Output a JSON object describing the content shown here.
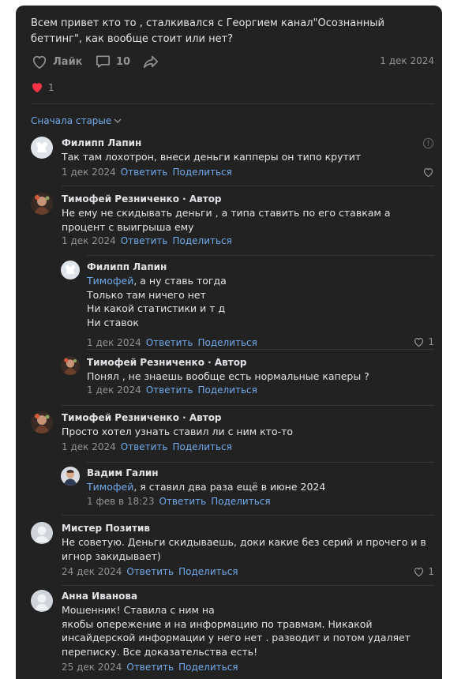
{
  "post": {
    "text": "Всем привет кто то , сталкивался с Георгием канал\"Осознанный беттинг\", как вообще стоит или нет?",
    "like_label": "Лайк",
    "comment_count": "10",
    "date": "1 дек 2024",
    "reaction_count": "1"
  },
  "sort_label": "Сначала старые",
  "reply_label": "Ответить",
  "share_label": "Поделиться",
  "comments": [
    {
      "name": "Филипп Лапин",
      "text": "Так там лохотрон, внеси деньги капперы он типо крутит",
      "date": "1 дек 2024"
    },
    {
      "name": "Тимофей Резниченко · Автор",
      "text": "Не ему не скидывать деньги , а типа ставить по его ставкам а процент с выигрыша ему",
      "date": "1 дек 2024"
    },
    {
      "name": "Филипп Лапин",
      "mention": "Тимофей",
      "text_l1": ", а ну ставь тогда",
      "text_l2": "Только там ничего нет",
      "text_l3": "Ни какой статистики и т д",
      "text_l4": "Ни ставок",
      "date": "1 дек 2024",
      "likes": "1"
    },
    {
      "name": "Тимофей Резниченко · Автор",
      "text": "Понял , не знаешь вообще есть нормальные каперы ?",
      "date": "1 дек 2024"
    },
    {
      "name": "Тимофей Резниченко · Автор",
      "text": "Просто хотел узнать ставил ли с ним кто-то",
      "date": "1 дек 2024"
    },
    {
      "name": "Вадим Галин",
      "mention": "Тимофей",
      "text": ", я ставил два раза ещё в июне 2024",
      "date": "1 фев в 18:23"
    },
    {
      "name": "Мистер Позитив",
      "text": "Не советую. Деньги скидываешь, доки какие без серий и прочего и в игнор закидывает)",
      "date": "24 дек 2024",
      "likes": "1"
    },
    {
      "name": "Анна Иванова",
      "text_l1": "Мошенник! Ставила с ним на",
      "text_l2": "якобы опережение и на информацию по травмам. Никакой инсайдерской информации у него нет . разводит и потом удаляет переписку. Все доказательства есть!",
      "date": "25 дек 2024"
    }
  ],
  "colors": {
    "background": "#222222",
    "text": "#e1e3e6",
    "muted": "#939393",
    "link": "#71aaeb",
    "heart": "#ff3347"
  },
  "icons": [
    "heart-outline-icon",
    "comment-icon",
    "share-icon",
    "heart-reaction-icon",
    "chevron-down-icon",
    "more-icon"
  ]
}
